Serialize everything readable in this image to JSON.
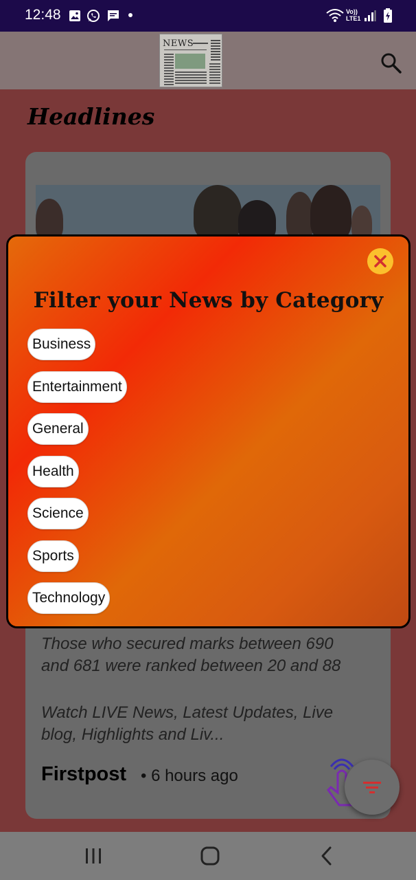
{
  "status_bar": {
    "time": "12:48",
    "notification_icons": [
      "gallery-icon",
      "whatsapp-icon",
      "message-icon",
      "dot-icon"
    ],
    "system_icons": [
      "wifi-icon",
      "signal-icon",
      "battery-charging-icon"
    ],
    "network_top": "Vo))",
    "network_bottom": "LTE1"
  },
  "app_bar": {
    "logo_text": "NEWS",
    "search_icon": "search-icon"
  },
  "page": {
    "heading": "Headlines"
  },
  "card": {
    "desc_line1": "Those who secured marks between 690",
    "desc_line2": "and 681 were ranked between 20 and 88",
    "desc2_line1": " Watch LIVE News, Latest Updates, Live",
    "desc2_line2": "blog, Highlights and Liv...",
    "source": "Firstpost",
    "time": "• 6 hours ago"
  },
  "dialog": {
    "title": "Filter your News by Category",
    "close_icon": "close-icon",
    "categories": [
      "Business",
      "Entertainment",
      "General",
      "Health",
      "Science",
      "Sports",
      "Technology"
    ]
  },
  "fab": {
    "icon": "filter-icon"
  },
  "nav_bar": {
    "buttons": [
      "recents-icon",
      "home-icon",
      "back-icon"
    ]
  },
  "colors": {
    "status_bar": "#1c0a4a",
    "dialog_gradient_start": "#e46a0a",
    "dialog_gradient_red": "#f22a06",
    "close_button": "#fbc02d",
    "filter_icon": "#d32f2f"
  }
}
